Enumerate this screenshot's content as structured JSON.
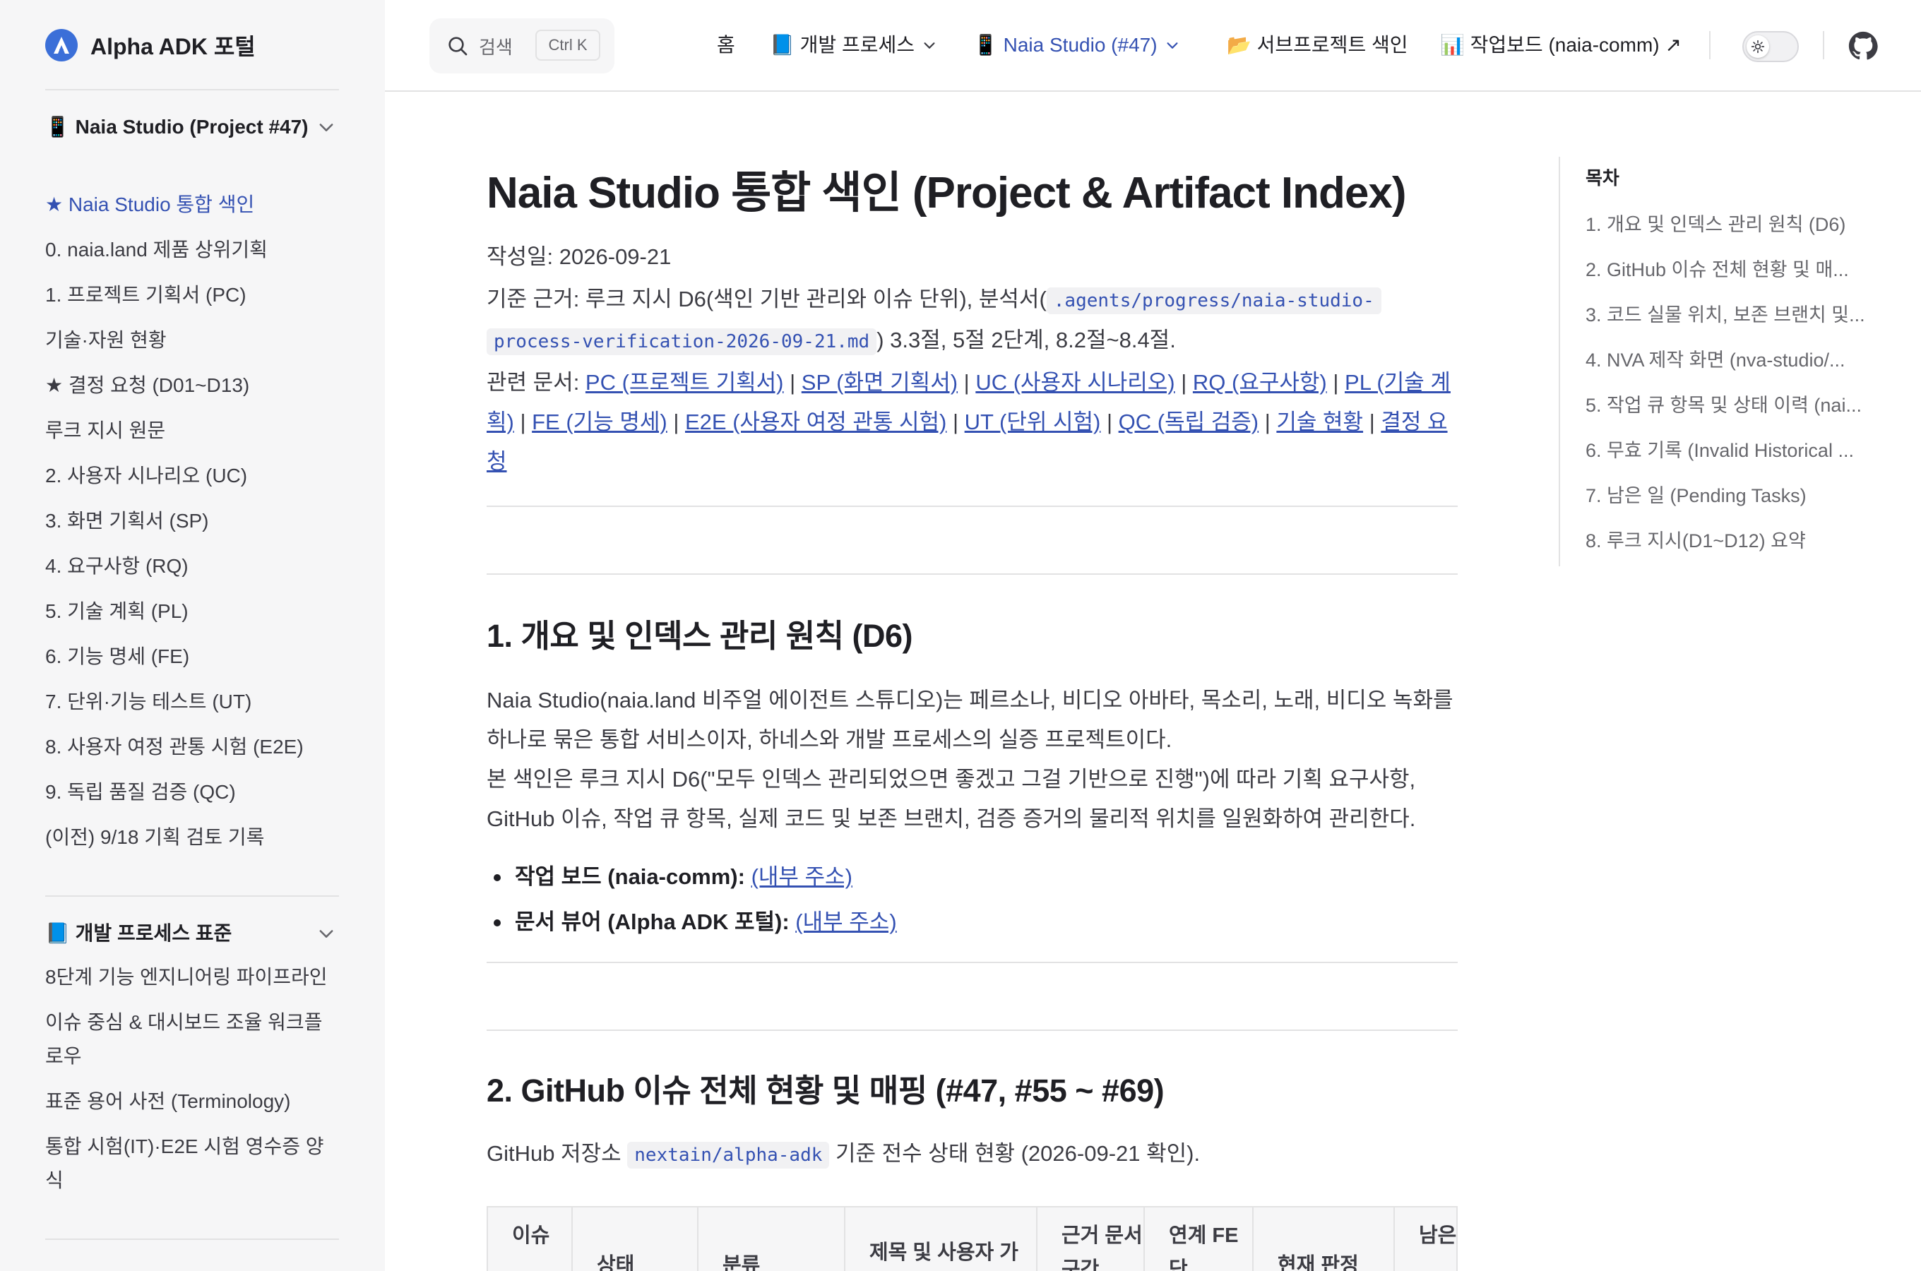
{
  "site": {
    "title": "Alpha ADK 포털"
  },
  "colors": {
    "accent": "#3451b2",
    "sidebar_bg": "#f6f6f7",
    "divider": "#e2e2e3"
  },
  "sidebar": {
    "group1_title": "📱 Naia Studio (Project #47)",
    "group1_items": [
      "★ Naia Studio 통합 색인",
      "0. naia.land 제품 상위기획",
      "1. 프로젝트 기획서 (PC)",
      "기술·자원 현황",
      "★ 결정 요청 (D01~D13)",
      "루크 지시 원문",
      "2. 사용자 시나리오 (UC)",
      "3. 화면 기획서 (SP)",
      "4. 요구사항 (RQ)",
      "5. 기술 계획 (PL)",
      "6. 기능 명세 (FE)",
      "7. 단위·기능 테스트 (UT)",
      "8. 사용자 여정 관통 시험 (E2E)",
      "9. 독립 품질 검증 (QC)",
      "(이전) 9/18 기획 검토 기록"
    ],
    "group2_title": "📘 개발 프로세스 표준",
    "group2_items": [
      "8단계 기능 엔지니어링 파이프라인",
      "이슈 중심 & 대시보드 조율 워크플로우",
      "표준 용어 사전 (Terminology)",
      "통합 시험(IT)·E2E 시험 영수증 양식"
    ]
  },
  "nav": {
    "search_label": "검색",
    "search_kbd": "Ctrl K",
    "items": [
      {
        "label": "홈"
      },
      {
        "label": "📘 개발 프로세스"
      },
      {
        "label": "📱 Naia Studio (#47)"
      },
      {
        "label": "📂 서브프로젝트 색인"
      },
      {
        "label": "📊 작업보드 (naia-comm) ↗"
      }
    ]
  },
  "doc": {
    "title": "Naia Studio 통합 색인 (Project & Artifact Index)",
    "date_line": "작성일: 2026-09-21",
    "basis_prefix": "기준 근거: 루크 지시 D6(색인 기반 관리와 이슈 단위), 분석서(",
    "basis_code_1": ".agents/progress/naia-studio-",
    "basis_code_2": "process-verification-2026-09-21.md",
    "basis_suffix": ") 3.3절, 5절 2단계, 8.2절~8.4절.",
    "related_prefix": "관련 문서: ",
    "related_links": [
      "PC (프로젝트 기획서)",
      "SP (화면 기획서)",
      "UC (사용자 시나리오)",
      "RQ (요구사항)",
      "PL (기술 계획)",
      "FE (기능 명세)",
      "E2E (사용자 여정 관통 시험)",
      "UT (단위 시험)",
      "QC (독립 검증)",
      "기술 현황",
      "결정 요청"
    ],
    "separator": " | ",
    "section1_title": "1. 개요 및 인덱스 관리 원칙 (D6)",
    "section1_p1": "Naia Studio(naia.land 비주얼 에이전트 스튜디오)는 페르소나, 비디오 아바타, 목소리, 노래, 비디오 녹화를 하나로 묶은 통합 서비스이자, 하네스와 개발 프로세스의 실증 프로젝트이다.",
    "section1_p2": "본 색인은 루크 지시 D6(\"모두 인덱스 관리되었으면 좋겠고 그걸 기반으로 진행\")에 따라 기획 요구사항, GitHub 이슈, 작업 큐 항목, 실제 코드 및 보존 브랜치, 검증 증거의 물리적 위치를 일원화하여 관리한다.",
    "bullet1_label": "작업 보드 (naia-comm):",
    "bullet1_link": "(내부 주소)",
    "bullet2_label": "문서 뷰어 (Alpha ADK 포털):",
    "bullet2_link": "(내부 주소)",
    "section2_title": "2. GitHub 이슈 전체 현황 및 매핑 (#47, #55 ~ #69)",
    "section2_prefix": "GitHub 저장소 ",
    "section2_code": "nextain/alpha-adk",
    "section2_suffix": " 기준 전수 상태 현황 (2026-09-21 확인).",
    "table_headers": [
      "이슈",
      "상태",
      "분류",
      "제목 및 사용자 가",
      "근거 문서 구간",
      "연계 FE 단",
      "현재 판정",
      "남은 일 (Pen"
    ]
  },
  "toc": {
    "title": "목차",
    "items": [
      "1. 개요 및 인덱스 관리 원칙 (D6)",
      "2. GitHub 이슈 전체 현황 및 매...",
      "3. 코드 실물 위치, 보존 브랜치 및...",
      "4. NVA 제작 화면 (nva-studio/...",
      "5. 작업 큐 항목 및 상태 이력 (nai...",
      "6. 무효 기록 (Invalid Historical ...",
      "7. 남은 일 (Pending Tasks)",
      "8. 루크 지시(D1~D12) 요약"
    ]
  }
}
